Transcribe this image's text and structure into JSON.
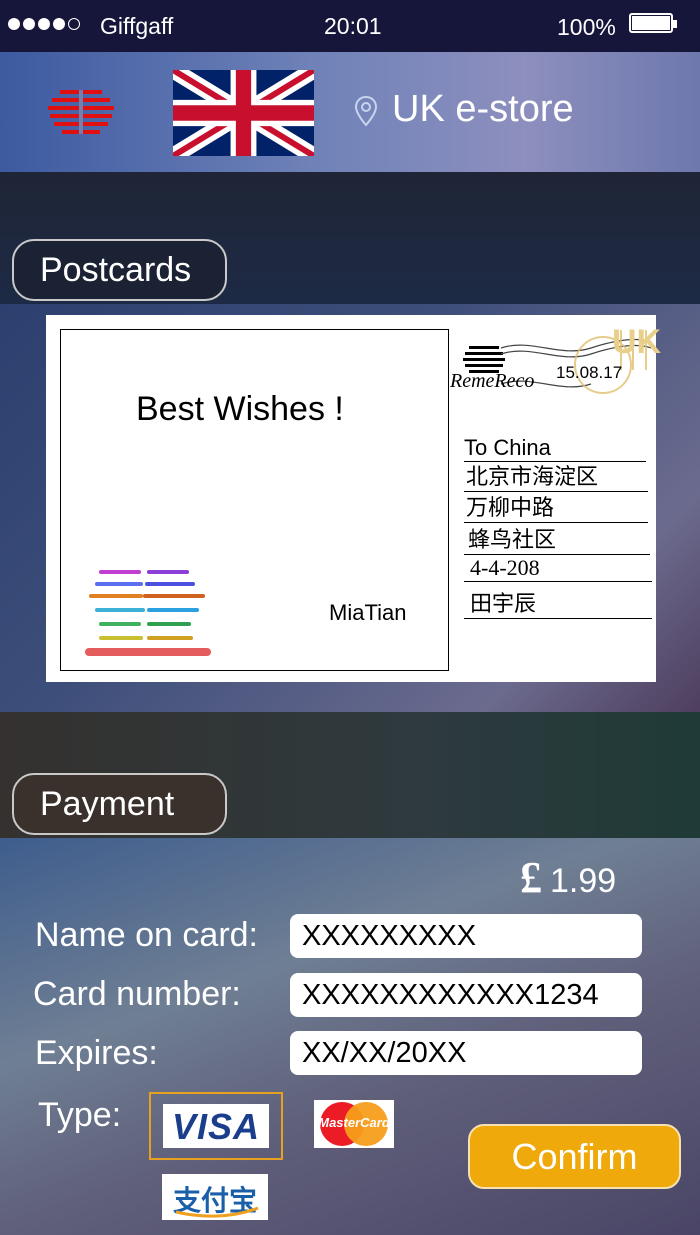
{
  "status_bar": {
    "carrier": "Giffgaff",
    "time": "20:01",
    "battery": "100%",
    "signal_bars": 4
  },
  "header": {
    "store_title": "UK e-store"
  },
  "sections": {
    "postcards_label": "Postcards",
    "payment_label": "Payment"
  },
  "postcard": {
    "greeting": "Best Wishes !",
    "signature": "MiaTian",
    "brand": "RemeReco",
    "postmark_date": "15.08.17",
    "stamp_text": "UK",
    "address": [
      "To China",
      "北京市海淀区",
      "万柳中路",
      "蜂鸟社区",
      "4-4-208",
      "田宇辰"
    ]
  },
  "payment": {
    "currency_symbol": "£",
    "amount": "1.99",
    "name_label": "Name on card:",
    "name_value": "XXXXXXXXX",
    "number_label": "Card number:",
    "number_value": "XXXXXXXXXXXX1234",
    "expires_label": "Expires:",
    "expires_value": "XX/XX/20XX",
    "type_label": "Type:",
    "visa_label": "VISA",
    "mastercard_label": "MasterCard",
    "alipay_label": "支付宝",
    "selected_type": "VISA",
    "confirm_label": "Confirm"
  },
  "colors": {
    "accent": "#efa90b",
    "logo_red": "#e01010",
    "selection_border": "#e6a11f"
  }
}
